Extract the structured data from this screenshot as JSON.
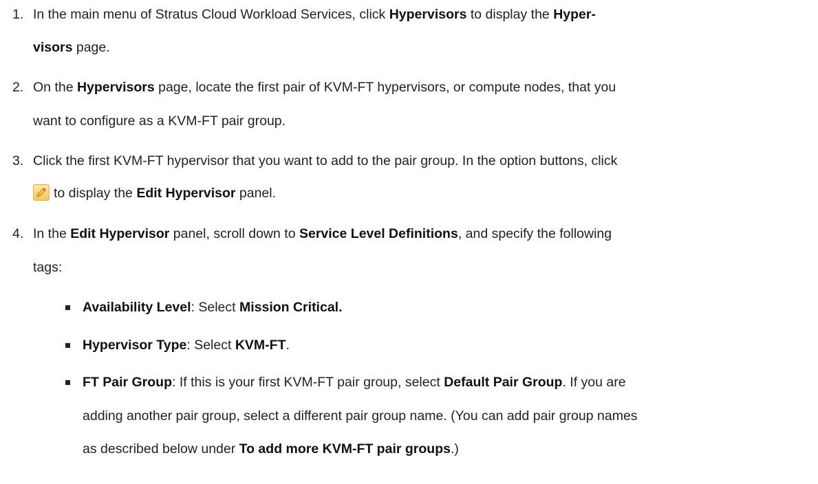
{
  "steps": [
    {
      "num": "1.",
      "l1_a": "In the main menu of Stratus Cloud Workload Services, click ",
      "l1_b": "Hypervisors",
      "l1_c": " to display the ",
      "l1_d": "Hyper-",
      "l2_a": "visors",
      "l2_b": " page."
    },
    {
      "num": "2.",
      "l1_a": "On the ",
      "l1_b": "Hypervisors",
      "l1_c": " page, locate the first pair of KVM-FT hypervisors, or compute nodes, that you",
      "l2_a": "want to configure as a KVM-FT pair group."
    },
    {
      "num": "3.",
      "l1_a": "Click the first KVM-FT hypervisor that you want to add to the pair group. In the option buttons, click",
      "l2_icon": "pencil-edit-icon",
      "l2_a": "to display the ",
      "l2_b": "Edit Hypervisor",
      "l2_c": " panel."
    },
    {
      "num": "4.",
      "l1_a": "In the ",
      "l1_b": "Edit Hypervisor",
      "l1_c": " panel, scroll down to ",
      "l1_d": "Service Level Definitions",
      "l1_e": ", and specify the following",
      "l2_a": "tags:"
    }
  ],
  "bullets": [
    {
      "a": "Availability Level",
      "b": ": Select ",
      "c": "Mission Critical."
    },
    {
      "a": "Hypervisor Type",
      "b": ": Select ",
      "c": "KVM-FT",
      "d": "."
    },
    {
      "l1_a": "FT Pair Group",
      "l1_b": ": If this is your first KVM-FT pair group, select ",
      "l1_c": "Default Pair Group",
      "l1_d": ". If you are",
      "l2_a": "adding another pair group, select a different pair group name. (You can add pair group names",
      "l3_a": "as described below under ",
      "l3_b": "To add more KVM-FT pair groups",
      "l3_c": ".)"
    }
  ]
}
